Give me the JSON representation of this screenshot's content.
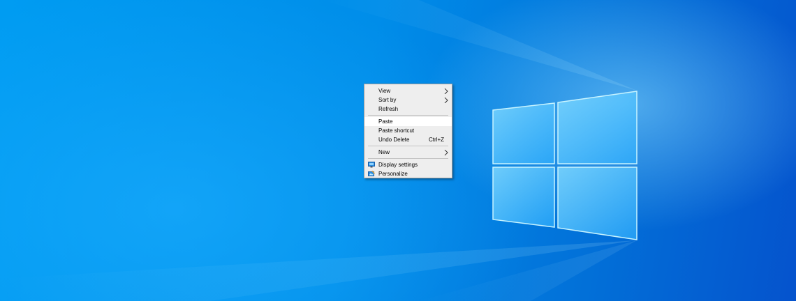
{
  "context_menu": {
    "items": [
      {
        "label": "View",
        "icon": "",
        "shortcut": "",
        "submenu": true,
        "highlighted": false
      },
      {
        "label": "Sort by",
        "icon": "",
        "shortcut": "",
        "submenu": true,
        "highlighted": false
      },
      {
        "label": "Refresh",
        "icon": "",
        "shortcut": "",
        "submenu": false,
        "highlighted": false
      },
      {
        "label": "Paste",
        "icon": "",
        "shortcut": "",
        "submenu": false,
        "highlighted": true
      },
      {
        "label": "Paste shortcut",
        "icon": "",
        "shortcut": "",
        "submenu": false,
        "highlighted": false
      },
      {
        "label": "Undo Delete",
        "icon": "",
        "shortcut": "Ctrl+Z",
        "submenu": false,
        "highlighted": false
      },
      {
        "label": "New",
        "icon": "",
        "shortcut": "",
        "submenu": true,
        "highlighted": false
      },
      {
        "label": "Display settings",
        "icon": "display-settings-icon",
        "shortcut": "",
        "submenu": false,
        "highlighted": false
      },
      {
        "label": "Personalize",
        "icon": "personalize-icon",
        "shortcut": "",
        "submenu": false,
        "highlighted": false
      }
    ]
  },
  "colors": {
    "desktop_blue": "#0078d7",
    "menu_background": "#eeeeee",
    "menu_highlight": "#ffffff"
  }
}
